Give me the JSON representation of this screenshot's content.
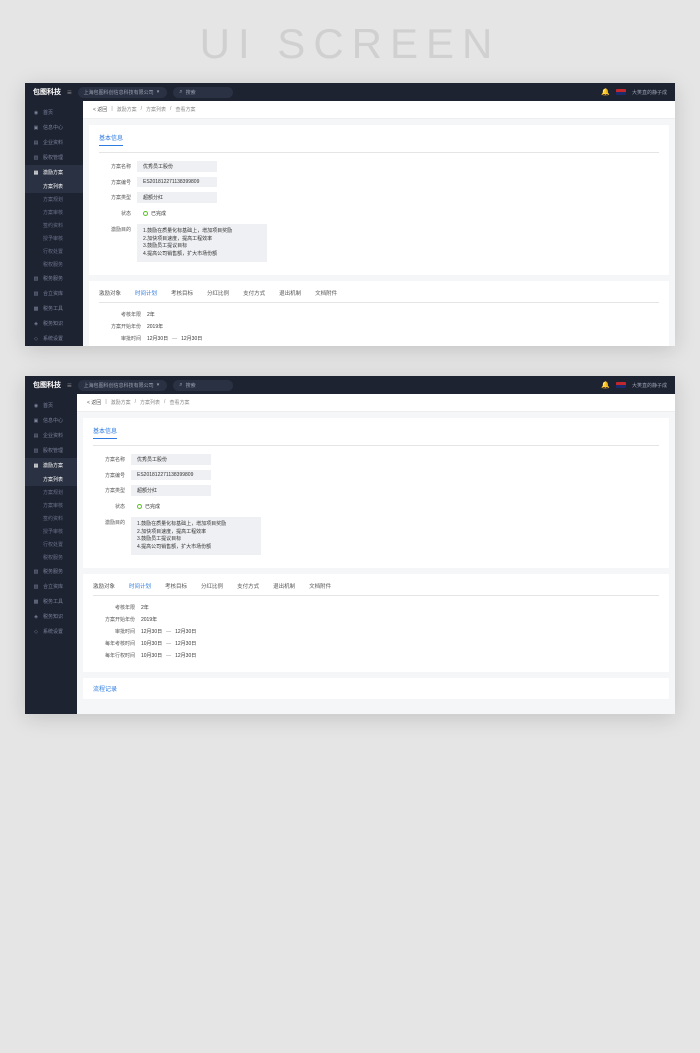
{
  "page_title": "UI SCREEN",
  "header": {
    "logo": "包图科技",
    "company": "上海包图科创信息科技有限公司",
    "search_placeholder": "搜索",
    "username": "大笑直的静子成"
  },
  "sidebar": {
    "items": [
      {
        "icon": "◉",
        "label": "首页"
      },
      {
        "icon": "▣",
        "label": "信息中心"
      },
      {
        "icon": "▤",
        "label": "企业资料"
      },
      {
        "icon": "▥",
        "label": "股权管理"
      },
      {
        "icon": "▦",
        "label": "激励方案",
        "active": true
      },
      {
        "icon": "▧",
        "label": "税务服务"
      },
      {
        "icon": "▨",
        "label": "合立资库"
      },
      {
        "icon": "▩",
        "label": "税务工具"
      },
      {
        "icon": "◈",
        "label": "税务知识"
      },
      {
        "icon": "◇",
        "label": "系统设置"
      }
    ],
    "subs": [
      {
        "label": "方案列表",
        "active": true
      },
      {
        "label": "方案规划"
      },
      {
        "label": "方案审核"
      },
      {
        "label": "签约资料"
      },
      {
        "label": "授予审核"
      },
      {
        "label": "行权处置"
      },
      {
        "label": "税权服务"
      }
    ]
  },
  "breadcrumb": {
    "back": "< 返回",
    "items": [
      "激励方案",
      "方案列表",
      "查看方案"
    ]
  },
  "basic": {
    "title": "基本信息",
    "fields": {
      "name_label": "方案名称",
      "name": "优秀员工股份",
      "code_label": "方案编号",
      "code": "ES201812271138399809",
      "type_label": "方案类型",
      "type": "超额分红",
      "status_label": "状态",
      "status": "已完成",
      "goal_label": "激励目的",
      "goals": [
        "1.鼓励在质量化标基础上，增加项目奖励",
        "2.加快项目速度，提高工程效率",
        "3.鼓励员工提议目标",
        "4.提高公司销售额，扩大市场份额"
      ]
    }
  },
  "tabs": {
    "items": [
      "激励对象",
      "时间计划",
      "考核目标",
      "分红比例",
      "支付方式",
      "退出机制",
      "文档附件"
    ],
    "active_index": 1
  },
  "time_plan": {
    "rows": [
      {
        "label": "考核年限",
        "val1": "2年"
      },
      {
        "label": "方案开始年份",
        "val1": "2019年"
      },
      {
        "label": "审批时间",
        "val1": "12月30日",
        "val2": "12月30日"
      },
      {
        "label": "每年考核时间",
        "val1": "10月30日",
        "val2": "12月30日"
      },
      {
        "label": "每年行权时间",
        "val1": "10月30日",
        "val2": "12月30日"
      }
    ]
  },
  "flow": {
    "title": "流程记录"
  }
}
